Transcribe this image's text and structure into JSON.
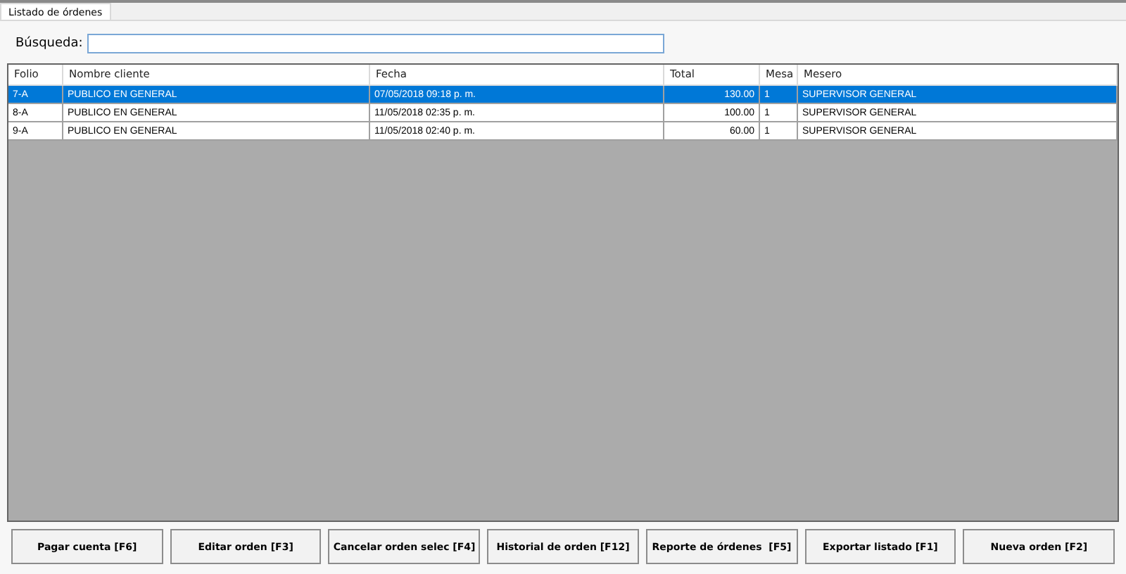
{
  "tabs": [
    {
      "label": "Listado de órdenes",
      "selected": true
    }
  ],
  "search": {
    "label": "Búsqueda:"
  },
  "table": {
    "columns": [
      "Folio",
      "Nombre cliente",
      "Fecha",
      "Total",
      "Mesa",
      "Mesero"
    ],
    "rows": [
      {
        "selected": true,
        "cells": [
          "7-A",
          "PUBLICO EN GENERAL",
          "07/05/2018 09:18 p. m.",
          "130.00",
          "1",
          "SUPERVISOR GENERAL"
        ]
      },
      {
        "selected": false,
        "cells": [
          "8-A",
          "PUBLICO EN GENERAL",
          "11/05/2018 02:35 p. m.",
          "100.00",
          "1",
          "SUPERVISOR GENERAL"
        ]
      },
      {
        "selected": false,
        "cells": [
          "9-A",
          "PUBLICO EN GENERAL",
          "11/05/2018 02:40 p. m.",
          "60.00",
          "1",
          "SUPERVISOR GENERAL"
        ]
      }
    ]
  },
  "buttons": [
    "Pagar cuenta [F6]",
    "Editar orden [F3]",
    "Cancelar orden selec [F4]",
    "Historial de orden [F12]",
    "Reporte de órdenes  [F5]",
    "Exportar listado [F1]",
    "Nueva orden [F2]"
  ]
}
